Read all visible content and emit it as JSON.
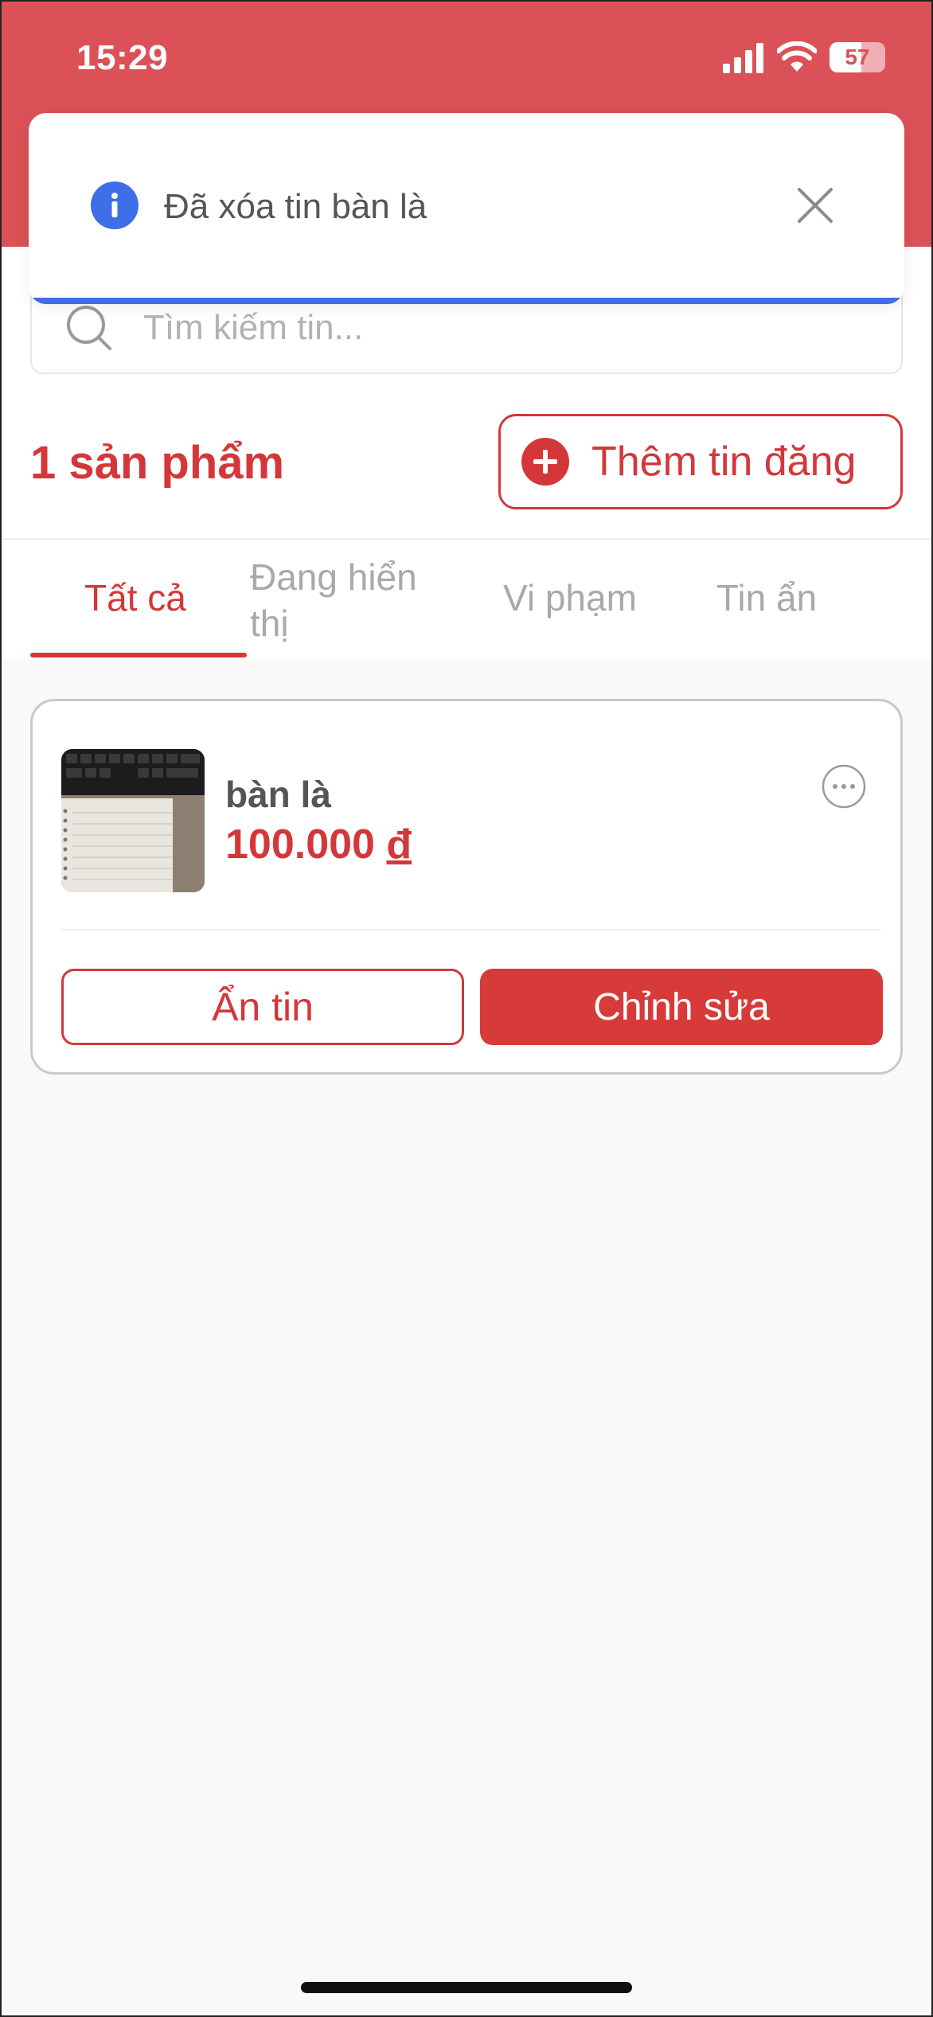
{
  "status_bar": {
    "time": "15:29",
    "battery_percent": "57",
    "battery_level": 0.57,
    "icons": [
      "signal-icon",
      "wifi-icon",
      "battery-icon"
    ]
  },
  "toast": {
    "message": "Đã xóa tin bàn là",
    "icon": "info-icon",
    "close_icon": "close-icon",
    "accent_color": "#3e6ee8"
  },
  "search": {
    "placeholder": "Tìm kiếm tin...",
    "value": ""
  },
  "summary": {
    "count_label": "1 sản phẩm",
    "add_button_label": "Thêm tin đăng"
  },
  "tabs": [
    {
      "label": "Tất cả",
      "active": true
    },
    {
      "label": "Đang hiển thị",
      "active": false
    },
    {
      "label": "Vi phạm",
      "active": false
    },
    {
      "label": "Tin ẩn",
      "active": false
    }
  ],
  "products": [
    {
      "title": "bàn là",
      "price": "100.000",
      "currency": "đ",
      "hide_label": "Ẩn tin",
      "edit_label": "Chỉnh sửa"
    }
  ],
  "colors": {
    "brand_red": "#d4373a",
    "header_red": "#dc5157",
    "info_blue": "#3e6ee8"
  }
}
